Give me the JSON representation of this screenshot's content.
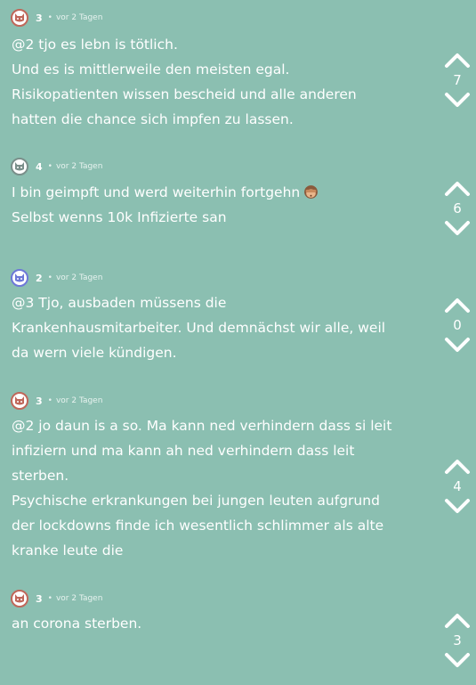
{
  "posts": [
    {
      "author": "3",
      "time": "vor 2 Tagen",
      "avatar_color": "#c0675a",
      "lines": [
        "@2 tjo es lebn is tötlich.",
        "Und es is mittlerweile den meisten egal.",
        "Risikopatienten wissen bescheid und alle anderen",
        "hatten die chance sich impfen zu lassen."
      ],
      "votes": "7"
    },
    {
      "author": "4",
      "time": "vor 2 Tagen",
      "avatar_color": "#7a8f8a",
      "lines": [
        "I bin geimpft und werd weiterhin fortgehn",
        "Selbst wenns 10k Infizierte san"
      ],
      "emoji": "see-no-evil-monkey",
      "votes": "6"
    },
    {
      "author": "2",
      "time": "vor 2 Tagen",
      "avatar_color": "#6e78d8",
      "lines": [
        "@3 Tjo, ausbaden müssens die",
        "Krankenhausmitarbeiter. Und demnächst wir alle, weil",
        "da wern viele kündigen."
      ],
      "votes": "0"
    },
    {
      "author": "3",
      "time": "vor 2 Tagen",
      "avatar_color": "#c0675a",
      "lines": [
        "@2 jo daun is a so. Ma kann ned verhindern dass si leit",
        "infiziern und ma kann ah ned verhindern dass leit",
        "sterben.",
        "Psychische erkrankungen bei jungen leuten aufgrund",
        "der lockdowns finde ich wesentlich schlimmer als alte",
        "kranke leute die"
      ],
      "votes": "4"
    },
    {
      "author": "3",
      "time": "vor 2 Tagen",
      "avatar_color": "#c0675a",
      "lines": [
        "an corona sterben."
      ],
      "votes": "3"
    }
  ],
  "separator": "•",
  "colors": {
    "background": "#8bbfb1",
    "text": "#ffffff"
  },
  "icons": {
    "upvote": "chevron-up-icon",
    "downvote": "chevron-down-icon",
    "avatar": "cat-face-icon"
  }
}
